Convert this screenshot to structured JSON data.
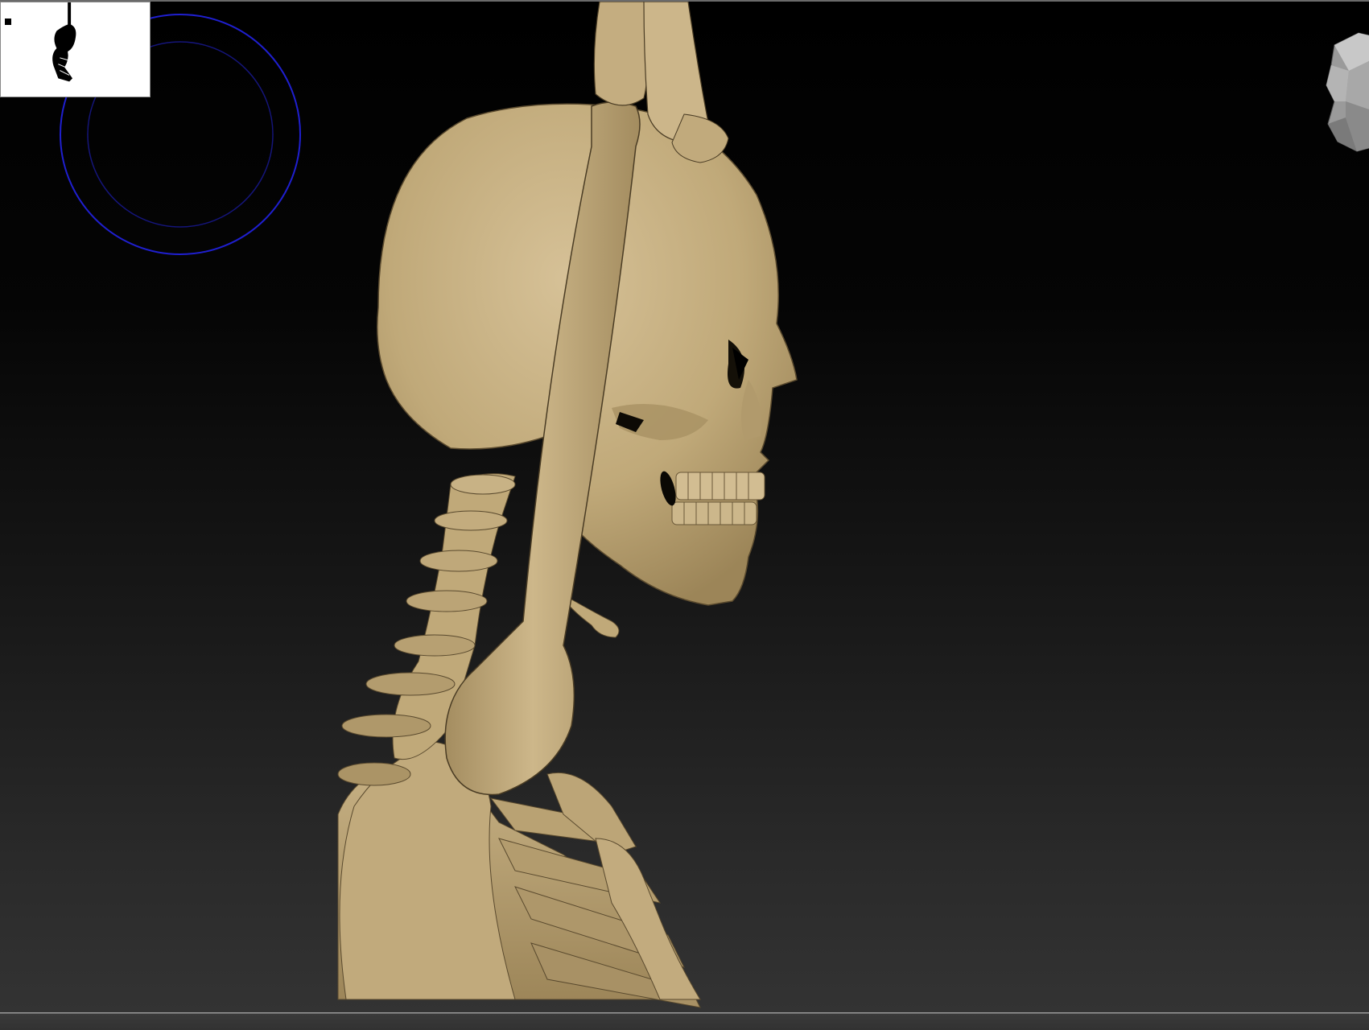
{
  "app": {
    "viewport_label": "",
    "colors": {
      "canvas_top": "#000000",
      "canvas_bottom": "#333333",
      "bone": "#c2ab7e",
      "bone_shadow": "#8a7650",
      "brush_ring": "#1a1ab8",
      "navigator_bg": "#ffffff"
    },
    "icons": {
      "navigator": "navigator-thumbnail",
      "brush": "brush-cursor-ring",
      "gizmo": "view-orientation-head-icon"
    }
  }
}
